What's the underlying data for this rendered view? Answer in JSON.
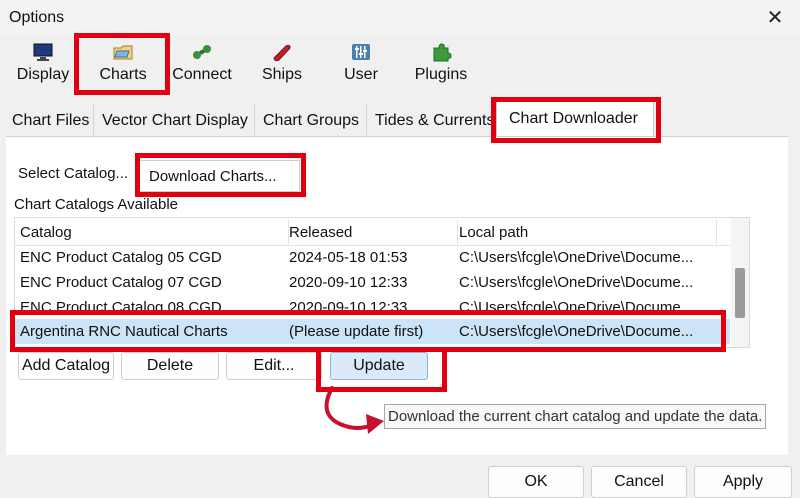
{
  "window": {
    "title": "Options",
    "close_glyph": "✕"
  },
  "toolbar": [
    {
      "label": "Display",
      "icon": "monitor-icon"
    },
    {
      "label": "Charts",
      "icon": "chart-folder-icon"
    },
    {
      "label": "Connect",
      "icon": "connect-icon"
    },
    {
      "label": "Ships",
      "icon": "ship-icon"
    },
    {
      "label": "User",
      "icon": "sliders-icon"
    },
    {
      "label": "Plugins",
      "icon": "puzzle-icon"
    }
  ],
  "tabs": [
    "Chart Files",
    "Vector Chart Display",
    "Chart Groups",
    "Tides & Currents",
    "Chart Downloader"
  ],
  "subtabs": {
    "select": "Select Catalog...",
    "download": "Download Charts..."
  },
  "section_label": "Chart Catalogs Available",
  "table": {
    "headers": [
      "Catalog",
      "Released",
      "Local path"
    ],
    "rows": [
      [
        "ENC Product Catalog 05 CGD",
        "2024-05-18 01:53",
        "C:\\Users\\fcgle\\OneDrive\\Docume..."
      ],
      [
        "ENC Product Catalog 07 CGD",
        "2020-09-10 12:33",
        "C:\\Users\\fcgle\\OneDrive\\Docume..."
      ],
      [
        "ENC Product Catalog 08 CGD",
        "2020-09-10 12:33",
        "C:\\Users\\fcgle\\OneDrive\\Docume..."
      ],
      [
        "Argentina RNC Nautical Charts",
        "(Please update first)",
        "C:\\Users\\fcgle\\OneDrive\\Docume..."
      ]
    ]
  },
  "buttons": {
    "add": "Add Catalog",
    "delete": "Delete",
    "edit": "Edit...",
    "update": "Update"
  },
  "tooltip": "Download the current chart catalog and update the data.",
  "footer": {
    "ok": "OK",
    "cancel": "Cancel",
    "apply": "Apply"
  },
  "colors": {
    "highlight": "#e0000f",
    "selected_row": "#cce4f7",
    "arrow": "#c8102e"
  }
}
